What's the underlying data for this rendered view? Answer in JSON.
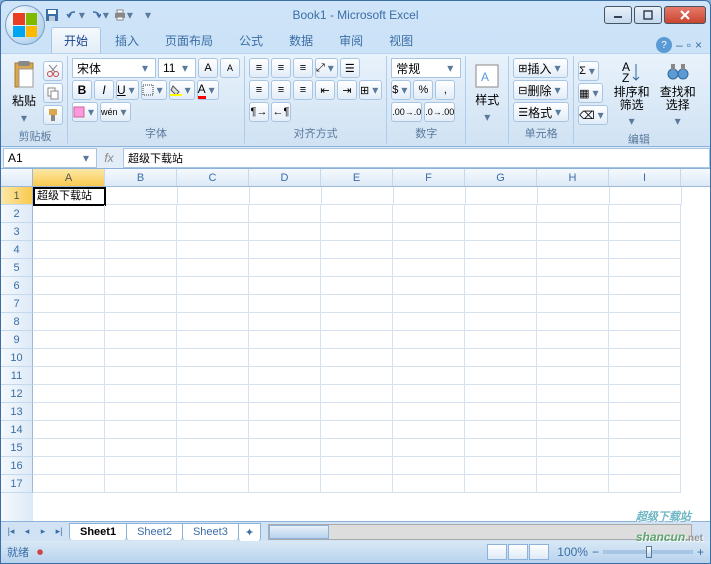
{
  "title": "Book1 - Microsoft Excel",
  "tabs": {
    "t0": "开始",
    "t1": "插入",
    "t2": "页面布局",
    "t3": "公式",
    "t4": "数据",
    "t5": "审阅",
    "t6": "视图"
  },
  "ribbon": {
    "clipboard": {
      "label": "剪贴板",
      "paste": "粘贴"
    },
    "font": {
      "label": "字体",
      "name": "宋体",
      "size": "11"
    },
    "align": {
      "label": "对齐方式"
    },
    "number": {
      "label": "数字",
      "format": "常规"
    },
    "styles": {
      "label": "",
      "btn": "样式"
    },
    "cells": {
      "label": "单元格",
      "insert": "插入",
      "delete": "删除",
      "format": "格式"
    },
    "editing": {
      "label": "编辑",
      "sort": "排序和\n筛选",
      "find": "查找和\n选择"
    }
  },
  "nameBox": "A1",
  "formula": "超级下载站",
  "cellA1": "超级下载站",
  "columns": [
    "A",
    "B",
    "C",
    "D",
    "E",
    "F",
    "G",
    "H",
    "I"
  ],
  "rows": [
    "1",
    "2",
    "3",
    "4",
    "5",
    "6",
    "7",
    "8",
    "9",
    "10",
    "11",
    "12",
    "13",
    "14",
    "15",
    "16",
    "17"
  ],
  "sheets": {
    "s1": "Sheet1",
    "s2": "Sheet2",
    "s3": "Sheet3"
  },
  "status": {
    "ready": "就绪",
    "zoom": "100%"
  },
  "watermark": {
    "main": "shancun",
    "sub": ".net",
    "pre": "超级下载站"
  },
  "chart_data": null
}
